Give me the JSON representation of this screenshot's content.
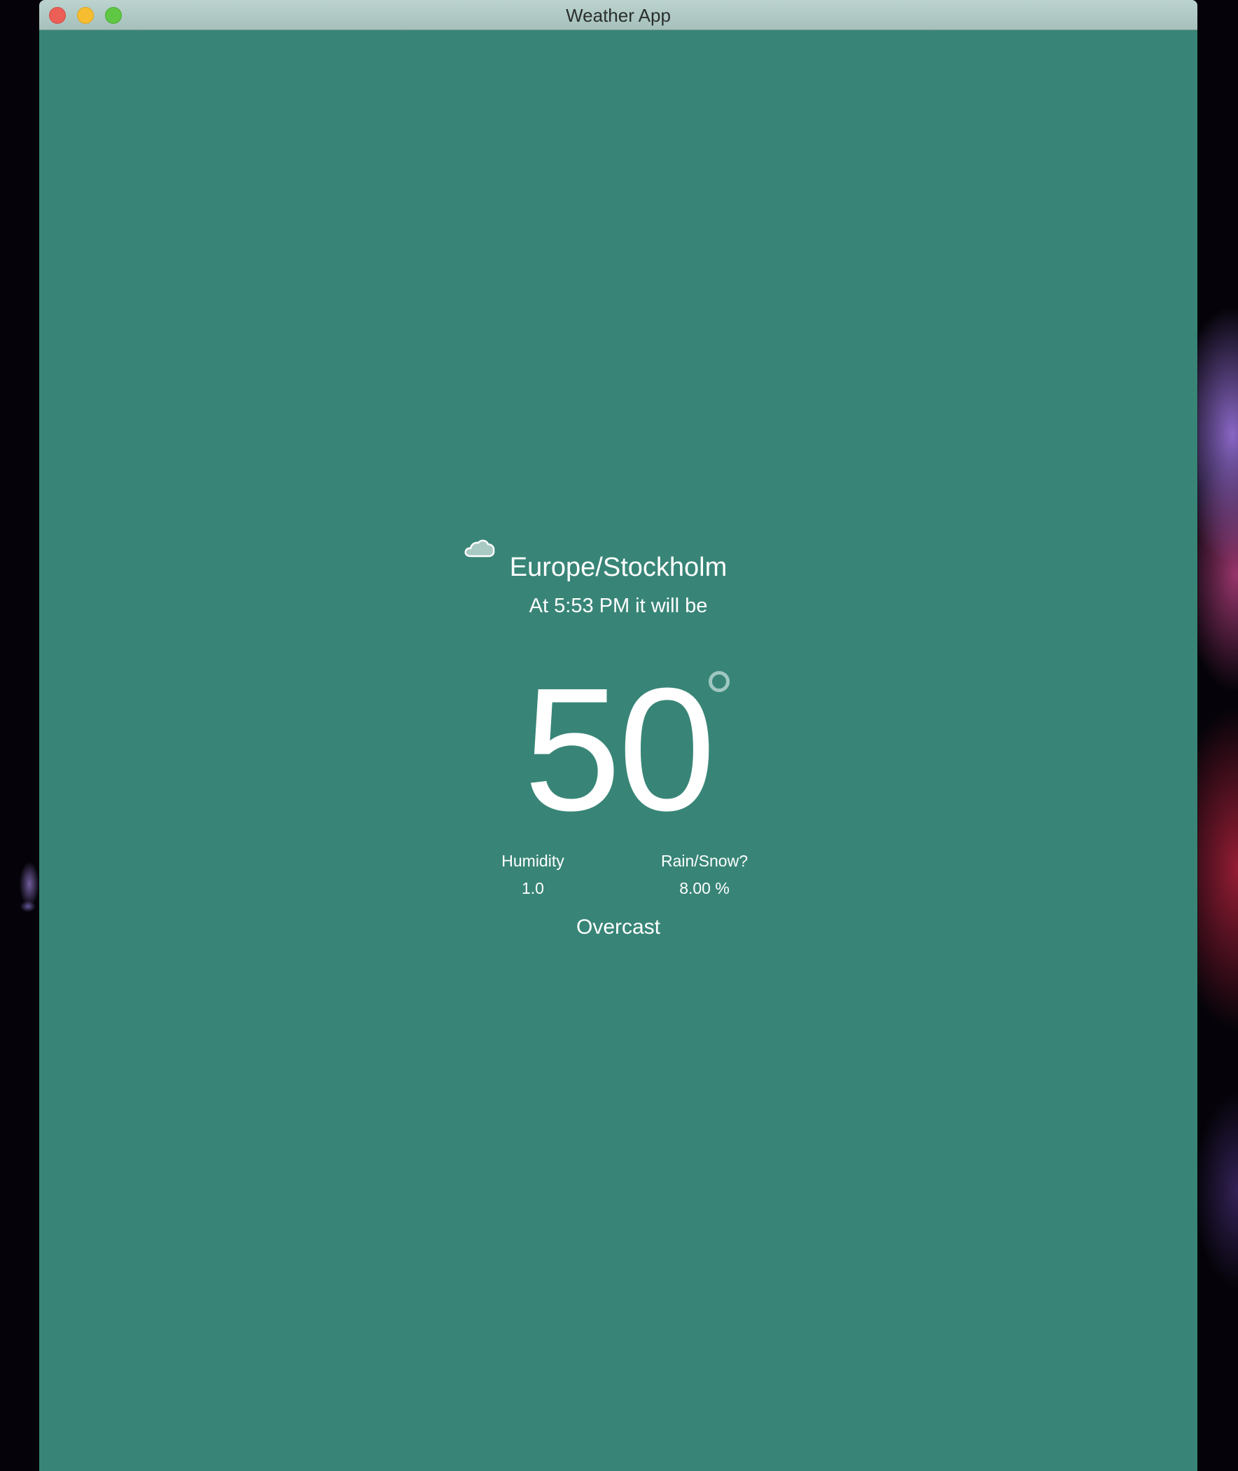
{
  "window": {
    "title": "Weather App"
  },
  "weather": {
    "location": "Europe/Stockholm",
    "time_line": "At 5:53 PM it will be",
    "temperature": "50",
    "humidity_label": "Humidity",
    "humidity_value": "1.0",
    "precip_label": "Rain/Snow?",
    "precip_value": "8.00 %",
    "condition": "Overcast",
    "icon": "cloud-icon"
  },
  "colors": {
    "background": "#388577",
    "text": "#ffffff",
    "degree_ring": "#9fc7c0"
  }
}
